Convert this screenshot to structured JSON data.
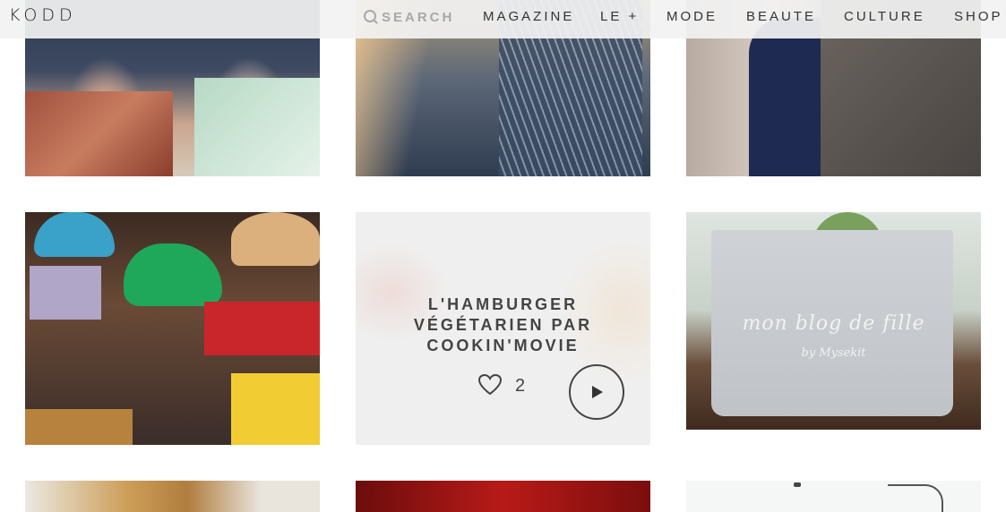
{
  "header": {
    "logo": "KODD",
    "search_label": "SEARCH",
    "nav": [
      {
        "label": "MAGAZINE"
      },
      {
        "label": "LE +"
      },
      {
        "label": "MODE"
      },
      {
        "label": "BEAUTE"
      },
      {
        "label": "CULTURE"
      },
      {
        "label": "SHOP"
      }
    ]
  },
  "tiles": {
    "featured": {
      "title": "L'HAMBURGER\nVÉGÉTARIEN PAR\nCOOKIN'MOVIE",
      "likes": "2"
    },
    "bag": {
      "text": "mon blog de fille",
      "sub": "by Mysekit"
    }
  },
  "colors": {
    "header_bg": "#f2f2f2",
    "text_dark": "#333333",
    "search_text": "#a8a8a8"
  }
}
